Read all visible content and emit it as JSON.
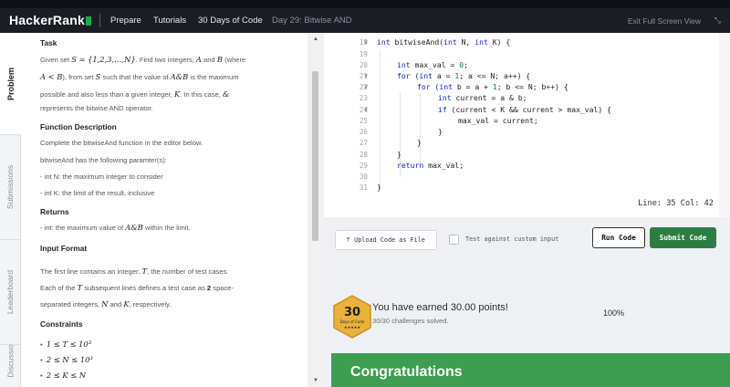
{
  "nav": {
    "logo_text": "HackerRank",
    "items": [
      "Prepare",
      "Tutorials",
      "30 Days of Code",
      "Day 29: Bitwise AND"
    ],
    "exit": "Exit Full Screen View",
    "expand_icon": "collapse-arrows-icon"
  },
  "sidetabs": [
    "Problem",
    "Submissions",
    "Leaderboard",
    "Discussions"
  ],
  "problem": {
    "task_heading": "Task",
    "task_l1a": "Given set",
    "task_l1b": ". Find two integers,",
    "task_l1c": "and",
    "task_l1d": "(where",
    "task_l2a": "), from set",
    "task_l2b": "such that the value of",
    "task_l2c": "is the maximum",
    "task_l3": "possible and also less than a given integer,",
    "task_l3b": ". In this case,",
    "task_l4": "represents the bitwise AND operator.",
    "math_S_def": "S = {1,2,3,…,N}",
    "math_A": "A",
    "math_B": "B",
    "math_AltB": "A < B",
    "math_S": "S",
    "math_AandB": "A&B",
    "math_K": "K",
    "math_amp": "&",
    "fd_heading": "Function Description",
    "fd_l1": "Complete the bitwiseAnd function in the editor below.",
    "fd_l2": "bitwiseAnd has the following paramter(s):",
    "fd_l3": "- int N: the maximum integer to consider",
    "fd_l4": "- int K: the limit of the result, inclusive",
    "ret_heading": "Returns",
    "ret_l1": "- int: the maximum value of",
    "ret_l1b": "within the limit.",
    "if_heading": "Input Format",
    "if_l1a": "The first line contains an integer,",
    "if_l1b": ", the number of test cases.",
    "if_l2a": "Each of the",
    "if_l2b": "subsequent lines defines a test case as",
    "if_l2c": "space-",
    "if_l3a": "separated integers,",
    "if_l3b": "and",
    "if_l3c": ", respectively.",
    "math_T": "T",
    "math_2": "2",
    "math_N": "N",
    "c_heading": "Constraints",
    "c1": "1 ≤ T ≤ 10³",
    "c2": "2 ≤ N ≤ 10³",
    "c3": "2 ≤ K ≤ N"
  },
  "editor": {
    "line_numbers": [
      "18",
      "19",
      "20",
      "21",
      "22",
      "23",
      "24",
      "25",
      "26",
      "27",
      "28",
      "29",
      "30",
      "31"
    ],
    "status": "Line: 35 Col: 42"
  },
  "toolbar": {
    "upload": "Upload Code as File",
    "upload_icon": "upload-icon",
    "custom_input": "Test against custom input",
    "run": "Run Code",
    "submit": "Submit Code"
  },
  "result": {
    "badge_number": "30",
    "badge_line": "Days of Code",
    "badge_stars": "★★★★★",
    "earned": "You have earned 30.00 points!",
    "solved": "30/30 challenges solved.",
    "percent": "100%",
    "congrats": "Congratulations"
  },
  "colors": {
    "brand_green": "#1ba94c",
    "submit_green": "#2d7d43",
    "congrats_green": "#3d9e52",
    "badge_gold": "#e9b23a"
  }
}
